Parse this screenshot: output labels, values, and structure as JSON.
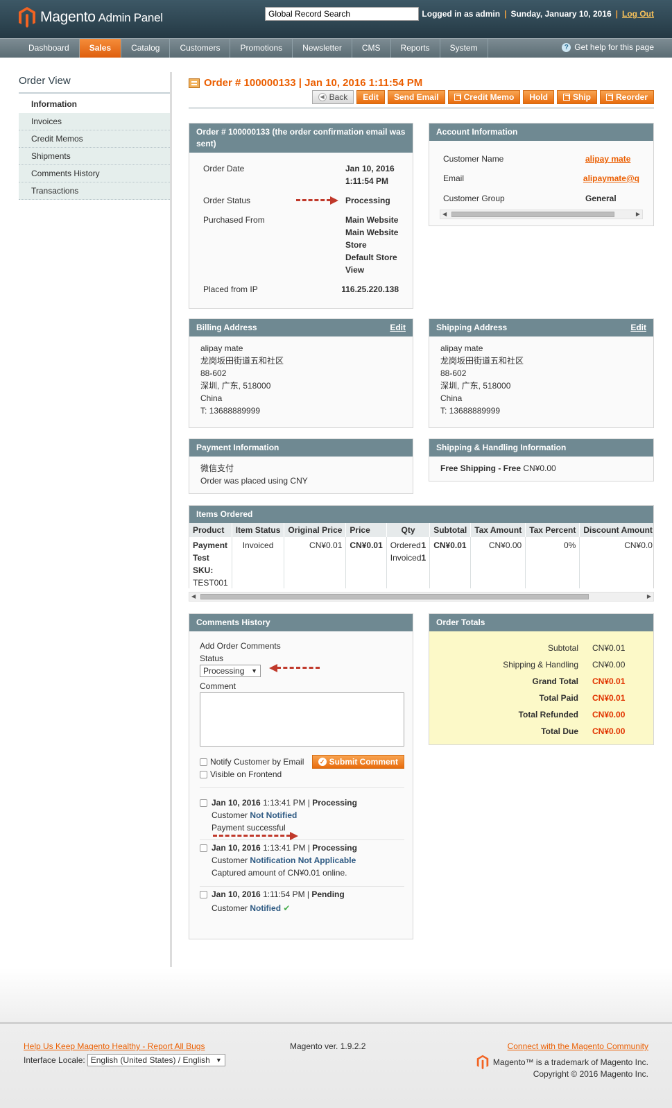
{
  "header": {
    "brand": "Magento",
    "brand_sub": "Admin Panel",
    "search_value": "Global Record Search",
    "logged_in": "Logged in as admin",
    "date": "Sunday, January 10, 2016",
    "logout": "Log Out"
  },
  "nav": {
    "items": [
      "Dashboard",
      "Sales",
      "Catalog",
      "Customers",
      "Promotions",
      "Newsletter",
      "CMS",
      "Reports",
      "System"
    ],
    "active": "Sales",
    "help": "Get help for this page"
  },
  "sidebar": {
    "title": "Order View",
    "items": [
      "Information",
      "Invoices",
      "Credit Memos",
      "Shipments",
      "Comments History",
      "Transactions"
    ]
  },
  "page": {
    "title": "Order # 100000133 | Jan 10, 2016 1:11:54 PM",
    "buttons": [
      "Back",
      "Edit",
      "Send Email",
      "Credit Memo",
      "Hold",
      "Ship",
      "Reorder"
    ]
  },
  "order_box": {
    "title": "Order # 100000133 (the order confirmation email was sent)",
    "order_date_label": "Order Date",
    "order_date_1": "Jan 10, 2016",
    "order_date_2": "1:11:54 PM",
    "status_label": "Order Status",
    "status": "Processing",
    "purchased_label": "Purchased From",
    "purchased_lines": [
      "Main Website",
      "Main Website",
      "Store",
      "Default Store",
      "View"
    ],
    "ip_label": "Placed from IP",
    "ip": "116.25.220.138"
  },
  "account_box": {
    "title": "Account Information",
    "name_label": "Customer Name",
    "name": "alipay mate",
    "email_label": "Email",
    "email": "alipaymate@q",
    "group_label": "Customer Group",
    "group": "General"
  },
  "billing": {
    "title": "Billing Address",
    "edit": "Edit",
    "lines": [
      "alipay mate",
      "龙岗坂田街道五和社区",
      "88-602",
      "深圳, 广东, 518000",
      "China",
      "T: 13688889999"
    ]
  },
  "shipping": {
    "title": "Shipping Address",
    "edit": "Edit",
    "lines": [
      "alipay mate",
      "龙岗坂田街道五和社区",
      "88-602",
      "深圳, 广东, 518000",
      "China",
      "T: 13688889999"
    ]
  },
  "payment": {
    "title": "Payment Information",
    "method": "微信支付",
    "note": "Order was placed using CNY"
  },
  "ship_handling": {
    "title": "Shipping & Handling Information",
    "method": "Free Shipping - Free",
    "amount": "CN¥0.00"
  },
  "items": {
    "title": "Items Ordered",
    "headers": [
      "Product",
      "Item Status",
      "Original Price",
      "Price",
      "Qty",
      "Subtotal",
      "Tax Amount",
      "Tax Percent",
      "Discount Amount"
    ],
    "product_name_1": "Payment",
    "product_name_2": "Test",
    "sku_label": "SKU:",
    "sku": "TEST001",
    "status": "Invoiced",
    "original_price": "CN¥0.01",
    "price": "CN¥0.01",
    "qty_ordered_label": "Ordered",
    "qty_ordered": "1",
    "qty_invoiced_label": "Invoiced",
    "qty_invoiced": "1",
    "subtotal": "CN¥0.01",
    "tax_amount": "CN¥0.00",
    "tax_percent": "0%",
    "discount": "CN¥0.0"
  },
  "comments": {
    "title": "Comments History",
    "add_label": "Add Order Comments",
    "status_label": "Status",
    "status_value": "Processing",
    "comment_label": "Comment",
    "notify_label": "Notify Customer by Email",
    "visible_label": "Visible on Frontend",
    "submit": "Submit Comment",
    "history": [
      {
        "date": "Jan 10, 2016",
        "time": "1:13:41 PM",
        "status": "Processing",
        "customer": "Customer",
        "notified": "Not Notified",
        "message": "Payment successful"
      },
      {
        "date": "Jan 10, 2016",
        "time": "1:13:41 PM",
        "status": "Processing",
        "customer": "Customer",
        "notified": "Notification Not Applicable",
        "message": "Captured amount of CN¥0.01 online."
      },
      {
        "date": "Jan 10, 2016",
        "time": "1:11:54 PM",
        "status": "Pending",
        "customer": "Customer",
        "notified": "Notified",
        "message": ""
      }
    ]
  },
  "totals": {
    "title": "Order Totals",
    "rows": [
      {
        "label": "Subtotal",
        "value": "CN¥0.01"
      },
      {
        "label": "Shipping & Handling",
        "value": "CN¥0.00"
      },
      {
        "label": "Grand Total",
        "value": "CN¥0.01"
      },
      {
        "label": "Total Paid",
        "value": "CN¥0.01"
      },
      {
        "label": "Total Refunded",
        "value": "CN¥0.00"
      },
      {
        "label": "Total Due",
        "value": "CN¥0.00"
      }
    ]
  },
  "footer": {
    "bug_link": "Help Us Keep Magento Healthy - Report All Bugs",
    "locale_label": "Interface Locale:",
    "locale_value": "English (United States) / English",
    "version": "Magento ver. 1.9.2.2",
    "community": "Connect with the Magento Community",
    "trademark": "Magento™ is a trademark of Magento Inc.",
    "copyright": "Copyright © 2016 Magento Inc."
  },
  "colors": {
    "accent": "#eb5e00",
    "box_header": "#6f8992",
    "totals_bg": "#fcf9c8",
    "annotation_arrow": "#c0392b"
  }
}
